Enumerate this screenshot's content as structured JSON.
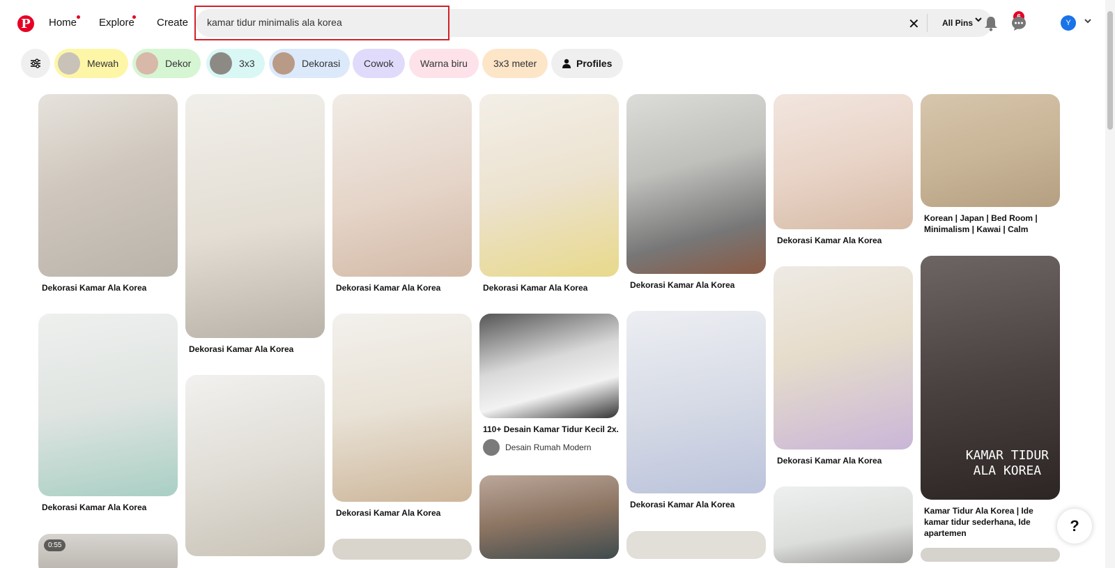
{
  "header": {
    "logo": "P",
    "nav": [
      {
        "label": "Home",
        "dot": true
      },
      {
        "label": "Explore",
        "dot": true
      },
      {
        "label": "Create",
        "dot": false
      }
    ],
    "search": {
      "value": "kamar tidur minimalis ala korea",
      "placeholder": "Search"
    },
    "clear_icon": "close-icon",
    "scope_label": "All Pins",
    "notifications_count": "6",
    "avatar_initial": "Y"
  },
  "filters": [
    {
      "label": "Mewah",
      "color": "#fdf6a6",
      "thumb": "#c8c2b8"
    },
    {
      "label": "Dekor",
      "color": "#d6f5d3",
      "thumb": "#d8b8a8"
    },
    {
      "label": "3x3",
      "color": "#d9f7f5",
      "thumb": "#8d8a86"
    },
    {
      "label": "Dekorasi",
      "color": "#dbe9fb",
      "thumb": "#b99a86"
    },
    {
      "label": "Cowok",
      "color": "#e0dbfb",
      "thumb": null
    },
    {
      "label": "Warna biru",
      "color": "#fde2ea",
      "thumb": null
    },
    {
      "label": "3x3 meter",
      "color": "#fde5c8",
      "thumb": null
    },
    {
      "label": "Profiles",
      "color": "#efefef",
      "thumb": null
    }
  ],
  "pins": [
    {
      "title": "Dekorasi Kamar Ala Korea"
    },
    {
      "title": "Dekorasi Kamar Ala Korea"
    },
    {
      "title": ""
    },
    {
      "title": "Dekorasi Kamar Ala Korea"
    },
    {
      "title": "Dekorasi Kamar Ala Korea"
    },
    {
      "title": ""
    },
    {
      "title": "Dekorasi Kamar Ala Korea"
    },
    {
      "title": "Dekorasi Kamar Ala Korea"
    },
    {
      "title": ""
    },
    {
      "title": "Dekorasi Kamar Ala Korea"
    },
    {
      "title": "110+ Desain Kamar Tidur Kecil 2x...",
      "author": "Desain Rumah Modern"
    },
    {
      "title": ""
    },
    {
      "title": "Dekorasi Kamar Ala Korea"
    },
    {
      "title": "Dekorasi Kamar Ala Korea"
    },
    {
      "title": ""
    },
    {
      "title": "Dekorasi Kamar Ala Korea"
    },
    {
      "title": "Dekorasi Kamar Ala Korea"
    },
    {
      "title": ""
    },
    {
      "title": "Korean | Japan | Bed Room | Minimalism | Kawai | Calm"
    },
    {
      "title": "Kamar Tidur Ala Korea | Ide kamar tidur sederhana, Ide apartemen",
      "overlay": "KAMAR TIDUR\nALA KOREA"
    },
    {
      "title": ""
    }
  ],
  "video_badge": "0:55",
  "help_label": "?"
}
